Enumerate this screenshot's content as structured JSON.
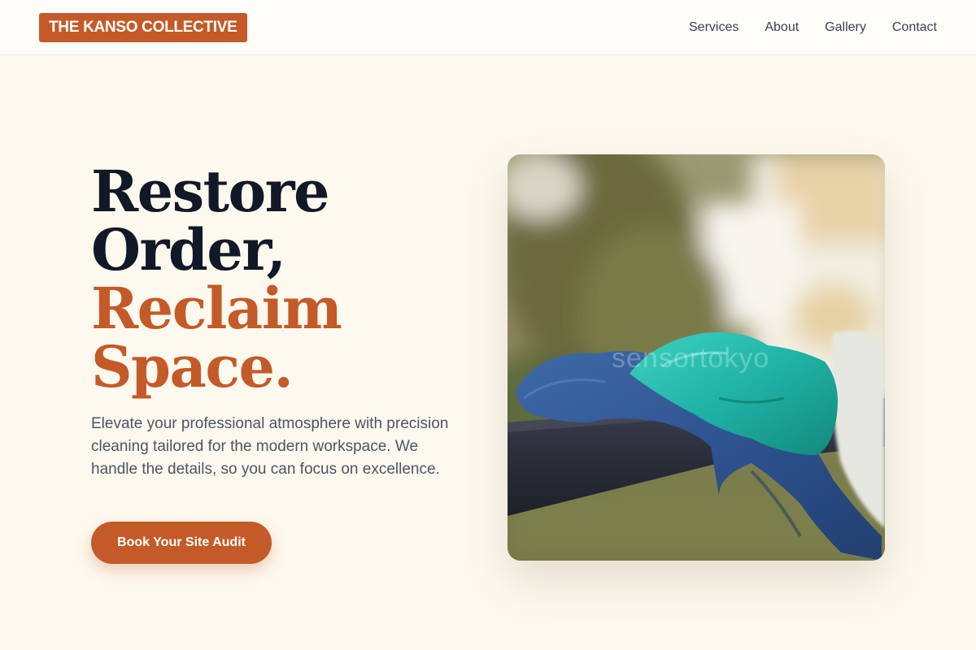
{
  "header": {
    "brand": "THE KANSO COLLECTIVE",
    "nav": [
      {
        "label": "Services"
      },
      {
        "label": "About"
      },
      {
        "label": "Gallery"
      },
      {
        "label": "Contact"
      }
    ]
  },
  "hero": {
    "headline_line1": "Restore",
    "headline_line2": "Order,",
    "headline_line3": "Reclaim",
    "headline_line4": "Space.",
    "subtext": "Elevate your professional atmosphere with precision cleaning tailored for the modern workspace. We handle the details, so you can focus on excellence.",
    "cta_label": "Book Your Site Audit",
    "image": {
      "subject": "blue microfiber cloth and teal rubber glove draped over a dark railing",
      "watermark": "sensortokyo"
    }
  },
  "colors": {
    "accent": "#c45a28",
    "background": "#fdf9ef",
    "headline_dark": "#111827",
    "body_text": "#4b5563"
  }
}
